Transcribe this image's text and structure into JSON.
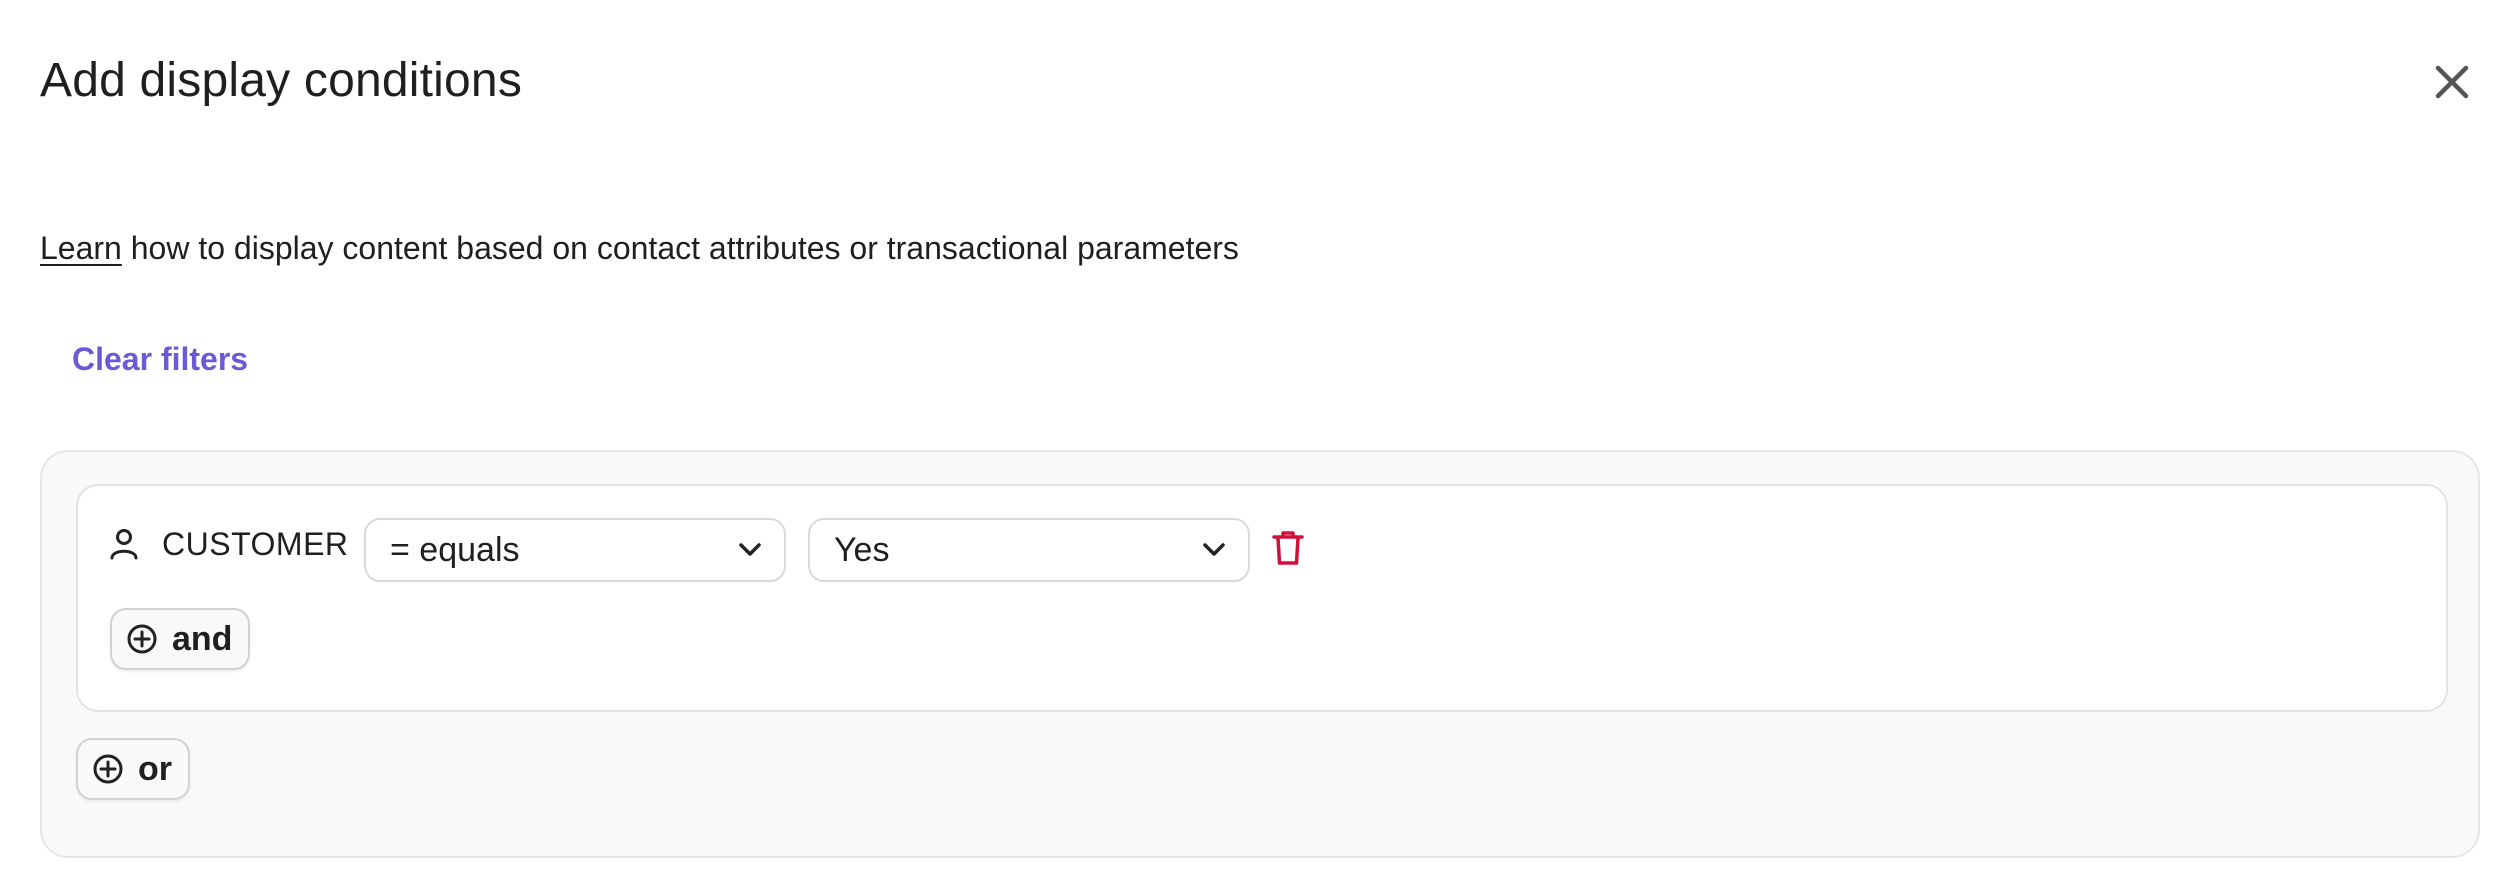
{
  "modal": {
    "title": "Add display conditions",
    "close_icon": "close-icon"
  },
  "intro": {
    "link_text": "Learn",
    "text": " how to display content based on contact attributes or transactional parameters"
  },
  "clear_filters_label": "Clear filters",
  "condition": {
    "attribute_icon": "person-icon",
    "attribute_label": "CUSTOMER",
    "operator_value": "= equals",
    "value_value": "Yes",
    "delete_icon": "trash-icon"
  },
  "buttons": {
    "and_label": "and",
    "or_label": "or",
    "add_icon": "plus-circle-icon"
  },
  "colors": {
    "accent": "#6a5ad6",
    "danger": "#d0103a",
    "group_background": "#f9f9f9"
  }
}
